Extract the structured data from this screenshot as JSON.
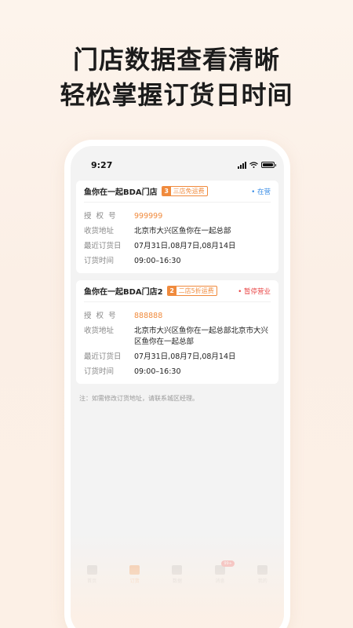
{
  "headline": {
    "line1": "门店数据查看清晰",
    "line2": "轻松掌握订货日时间"
  },
  "status_bar": {
    "time": "9:27"
  },
  "stores": [
    {
      "name": "鱼你在一起BDA门店",
      "tag_num": "3",
      "tag_text": "三店免运费",
      "status": "• 在营",
      "auth_label": "授  权  号",
      "auth_value": "999999",
      "addr_label": "收货地址",
      "addr_value": "北京市大兴区鱼你在一起总部",
      "recent_label": "最近订货日",
      "recent_value": "07月31日,08月7日,08月14日",
      "time_label": "订货时间",
      "time_value": "09:00–16:30"
    },
    {
      "name": "鱼你在一起BDA门店2",
      "tag_num": "2",
      "tag_text": "二店5折运费",
      "status": "• 暂停营业",
      "auth_label": "授  权  号",
      "auth_value": "888888",
      "addr_label": "收货地址",
      "addr_value": "北京市大兴区鱼你在一起总部北京市大兴区鱼你在一起总部",
      "recent_label": "最近订货日",
      "recent_value": "07月31日,08月7日,08月14日",
      "time_label": "订货时间",
      "time_value": "09:00–16:30"
    }
  ],
  "note": "注：如需修改订货地址，请联系城区经理。",
  "tabbar": {
    "items": [
      {
        "label": "首页",
        "icon": "home-icon"
      },
      {
        "label": "订货",
        "icon": "cart-icon"
      },
      {
        "label": "数据",
        "icon": "chart-icon"
      },
      {
        "label": "消息",
        "icon": "message-icon",
        "badge": "99+"
      },
      {
        "label": "我的",
        "icon": "user-icon"
      }
    ]
  },
  "colors": {
    "accent": "#f08a3c",
    "open": "#3a8ee6",
    "closed": "#e84444"
  }
}
